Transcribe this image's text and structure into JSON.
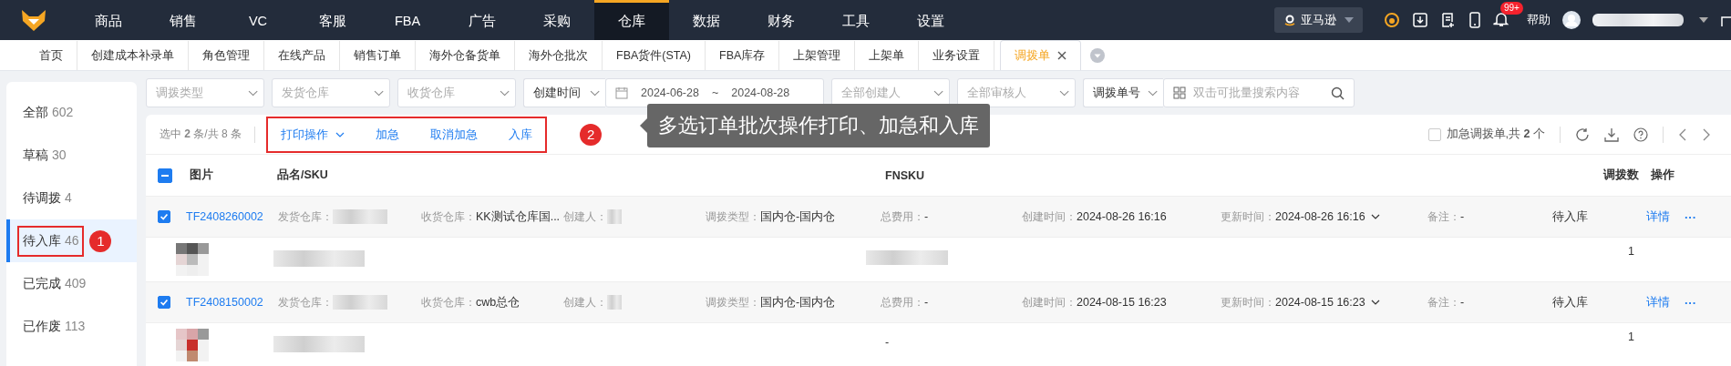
{
  "nav": {
    "items": [
      {
        "label": "商品",
        "selected": false
      },
      {
        "label": "销售",
        "selected": false
      },
      {
        "label": "VC",
        "selected": false
      },
      {
        "label": "客服",
        "selected": false
      },
      {
        "label": "FBA",
        "selected": false
      },
      {
        "label": "广告",
        "selected": false
      },
      {
        "label": "采购",
        "selected": false
      },
      {
        "label": "仓库",
        "selected": true
      },
      {
        "label": "数据",
        "selected": false
      },
      {
        "label": "财务",
        "selected": false
      },
      {
        "label": "工具",
        "selected": false
      },
      {
        "label": "设置",
        "selected": false
      }
    ],
    "platform": "亚马逊",
    "badge": "99+",
    "help": "帮助"
  },
  "tabs": [
    {
      "label": "首页",
      "selected": false
    },
    {
      "label": "创建成本补录单",
      "selected": false
    },
    {
      "label": "角色管理",
      "selected": false
    },
    {
      "label": "在线产品",
      "selected": false
    },
    {
      "label": "销售订单",
      "selected": false
    },
    {
      "label": "海外仓备货单",
      "selected": false
    },
    {
      "label": "海外仓批次",
      "selected": false
    },
    {
      "label": "FBA货件(STA)",
      "selected": false
    },
    {
      "label": "FBA库存",
      "selected": false
    },
    {
      "label": "上架管理",
      "selected": false
    },
    {
      "label": "上架单",
      "selected": false
    },
    {
      "label": "业务设置",
      "selected": false
    },
    {
      "label": "调拨单",
      "selected": true
    }
  ],
  "sidebar": {
    "items": [
      {
        "label": "全部",
        "count": "602",
        "selected": false,
        "annotated": false
      },
      {
        "label": "草稿",
        "count": "30",
        "selected": false,
        "annotated": false
      },
      {
        "label": "待调拨",
        "count": "4",
        "selected": false,
        "annotated": false
      },
      {
        "label": "待入库",
        "count": "46",
        "selected": true,
        "annotated": true
      },
      {
        "label": "已完成",
        "count": "409",
        "selected": false,
        "annotated": false
      },
      {
        "label": "已作废",
        "count": "113",
        "selected": false,
        "annotated": false
      }
    ]
  },
  "filters": {
    "transfer_type": {
      "placeholder": "调拨类型"
    },
    "from_warehouse": {
      "placeholder": "发货仓库"
    },
    "to_warehouse": {
      "placeholder": "收货仓库"
    },
    "time_field": "创建时间",
    "date_from": "2024-06-28",
    "date_sep": "~",
    "date_to": "2024-08-28",
    "creator": {
      "placeholder": "全部创建人"
    },
    "reviewer": {
      "placeholder": "全部审核人"
    },
    "search_field": "调拨单号",
    "search": {
      "placeholder": "双击可批量搜索内容"
    }
  },
  "toolbar": {
    "selection": "选中 **2** 条/共 8 条",
    "actions_annotated": true,
    "actions": [
      {
        "label": "打印操作",
        "kind": "dropdown"
      },
      {
        "label": "加急",
        "kind": "link"
      },
      {
        "label": "取消加急",
        "kind": "link"
      },
      {
        "label": "入库",
        "kind": "link"
      }
    ],
    "urgent_filter": {
      "label": "加急调拨单,共 **2** 个",
      "checked": false
    }
  },
  "callouts": [
    {
      "number": "1"
    },
    {
      "number": "2",
      "text": "多选订单批次操作打印、加急和入库"
    }
  ],
  "table": {
    "header_checkbox": {
      "indeterminate": true
    },
    "columns": [
      "图片",
      "品名/SKU",
      "FNSKU",
      "调拨数",
      "操作"
    ],
    "rows": [
      {
        "checked": true,
        "order_no": "TF2408260002",
        "from_label": "发货仓库：",
        "to_label": "收货仓库：",
        "to": "KK测试仓库国...",
        "creator_label": "创建人：",
        "type_label": "调拨类型：",
        "type": "国内仓-国内仓",
        "fee_label": "总费用：",
        "fee": "-",
        "created_label": "创建时间：",
        "created": "2024-08-26 16:16",
        "updated_label": "更新时间：",
        "updated": "2024-08-26 16:16",
        "note_label": "备注：",
        "note": "-",
        "status": "待入库",
        "detail": "详情",
        "more": "···",
        "qty": "1"
      },
      {
        "checked": true,
        "order_no": "TF2408150002",
        "from_label": "发货仓库：",
        "to_label": "收货仓库：",
        "to": "cwb总仓",
        "creator_label": "创建人：",
        "type_label": "调拨类型：",
        "type": "国内仓-国内仓",
        "fee_label": "总费用：",
        "fee": "-",
        "created_label": "创建时间：",
        "created": "2024-08-15 16:23",
        "updated_label": "更新时间：",
        "updated": "2024-08-15 16:23",
        "note_label": "备注：",
        "note": "-",
        "status": "待入库",
        "detail": "详情",
        "more": "···",
        "fnsku": "-",
        "qty": "1"
      }
    ]
  }
}
